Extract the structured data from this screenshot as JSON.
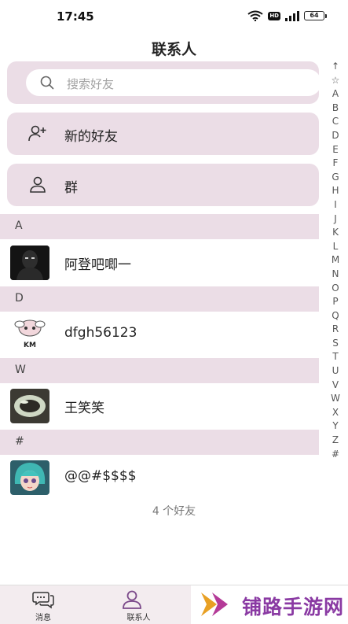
{
  "status_bar": {
    "time": "17:45",
    "battery": "64",
    "hd": "HD"
  },
  "header": {
    "title": "联系人"
  },
  "search": {
    "placeholder": "搜索好友"
  },
  "menu": [
    {
      "label": "新的好友",
      "icon": "add-user-icon"
    },
    {
      "label": "群",
      "icon": "user-icon"
    }
  ],
  "sections": [
    {
      "letter": "A",
      "contacts": [
        {
          "name": "阿登吧唧一"
        }
      ]
    },
    {
      "letter": "D",
      "contacts": [
        {
          "name": "dfgh56123",
          "avatar_text": "KM"
        }
      ]
    },
    {
      "letter": "W",
      "contacts": [
        {
          "name": "王笑笑"
        }
      ]
    },
    {
      "letter": "#",
      "contacts": [
        {
          "name": "@@#$$$$"
        }
      ]
    }
  ],
  "friend_count": "4 个好友",
  "index_bar": [
    "↑",
    "☆",
    "A",
    "B",
    "C",
    "D",
    "E",
    "F",
    "G",
    "H",
    "I",
    "J",
    "K",
    "L",
    "M",
    "N",
    "O",
    "P",
    "Q",
    "R",
    "S",
    "T",
    "U",
    "V",
    "W",
    "X",
    "Y",
    "Z",
    "#"
  ],
  "nav": {
    "messages": "消息",
    "contacts": "联系人"
  },
  "watermark": "铺路手游网",
  "colors": {
    "accent_bg": "#ebdde6",
    "watermark": "#8a3aa3",
    "nav_active": "#7b4a8a"
  }
}
